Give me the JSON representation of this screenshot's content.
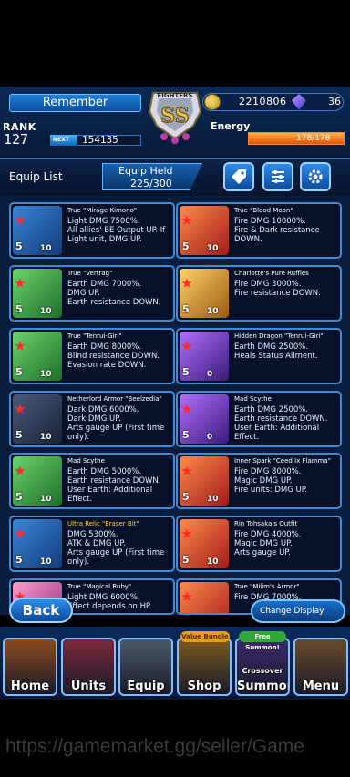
{
  "header": {
    "player_name": "Remember",
    "logo_text": "FIGHTERS SS",
    "gold": "2210806",
    "gems": "36",
    "rank_label": "RANK",
    "rank": "127",
    "next_label": "NEXT",
    "next_value": "154135",
    "energy_label": "Energy",
    "energy_value": "178/178",
    "energy_fraction": 1.0
  },
  "equip_bar": {
    "title": "Equip List",
    "held_label": "Equip Held",
    "held_value": "225/300"
  },
  "cards": [
    {
      "name": "True \"Mirage Kimono\"",
      "desc": "Light DMG 7500%.\nAll allies' BE Output UP. If Light unit, DMG UP.",
      "level": "5",
      "sub": "10",
      "color": "c-blue"
    },
    {
      "name": "True \"Blood Moon\"",
      "desc": "Fire DMG 10000%.\nFire & Dark resistance DOWN.",
      "level": "5",
      "sub": "10",
      "color": "c-red"
    },
    {
      "name": "True \"Vertrag\"",
      "desc": "Earth DMG 7000%.\nDMG UP.\nEarth resistance DOWN.",
      "level": "5",
      "sub": "10",
      "color": "c-green"
    },
    {
      "name": "Charlotte's Pure Ruffles",
      "desc": "Fire DMG 3000%.\nFire resistance DOWN.",
      "level": "5",
      "sub": "10",
      "color": "c-gold"
    },
    {
      "name": "True \"Tenrui-Giri\"",
      "desc": "Earth DMG 8000%.\nBlind resistance DOWN.\nEvasion rate DOWN.",
      "level": "5",
      "sub": "10",
      "color": "c-green"
    },
    {
      "name": "Hidden Dragon \"Tenrui-Giri\"",
      "desc": "Earth DMG 2500%.\nHeals Status Ailment.",
      "level": "5",
      "sub": "0",
      "color": "c-purple"
    },
    {
      "name": "Netherlord Armor \"Beelzedia\"",
      "desc": "Dark DMG 6000%.\nDark DMG UP.\nArts gauge UP (First time only).",
      "level": "5",
      "sub": "10",
      "color": "c-dark"
    },
    {
      "name": "Mad Scythe",
      "desc": "Earth DMG 2500%.\nEarth resistance DOWN. User Earth: Additional Effect.",
      "level": "5",
      "sub": "0",
      "color": "c-purple"
    },
    {
      "name": "Mad Scythe",
      "desc": "Earth DMG 5000%.\nEarth resistance DOWN. User Earth: Additional Effect.",
      "level": "5",
      "sub": "10",
      "color": "c-green"
    },
    {
      "name": "Inner Spark \"Ceed Ix Flamma\"",
      "desc": "Fire DMG 8000%.\nMagic DMG UP.\nFire units: DMG UP.",
      "level": "5",
      "sub": "10",
      "color": "c-red"
    },
    {
      "name": "Ultra Relic \"Eraser Bit\"",
      "desc": "DMG 5300%.\nATK & DMG UP.\nArts gauge UP (First time only).",
      "level": "5",
      "sub": "10",
      "color": "c-blue",
      "gold": true
    },
    {
      "name": "Rin Tohsaka's Outfit",
      "desc": "Fire DMG 4000%.\nMagic DMG UP.\nArts gauge UP.",
      "level": "5",
      "sub": "10",
      "color": "c-red"
    },
    {
      "name": "True \"Magical Ruby\"",
      "desc": "Light DMG 6000%.\nEffect depends on HP.",
      "level": "5",
      "sub": "10",
      "color": "c-pink"
    },
    {
      "name": "True \"Milim's Armor\"",
      "desc": "Fire DMG 7000%.",
      "level": "5",
      "sub": "10",
      "color": "c-red"
    }
  ],
  "back_label": "Back",
  "change_display_label": "Change Display",
  "nav": [
    {
      "label": "Home",
      "color": "#8a4a1e"
    },
    {
      "label": "Units",
      "color": "#7a2a3a"
    },
    {
      "label": "Equip",
      "color": "#4a5a6a"
    },
    {
      "label": "Shop",
      "color": "#7a5a1e"
    },
    {
      "label": "Summon",
      "color": "#3a2a6a"
    },
    {
      "label": "Menu",
      "color": "#6a4a2a"
    }
  ],
  "nav_badges": {
    "shop": "Value Bundle",
    "summon": "Free Summon!",
    "summon_sub": "Crossover"
  },
  "watermark": "https://gamemarket.gg/seller/Game"
}
